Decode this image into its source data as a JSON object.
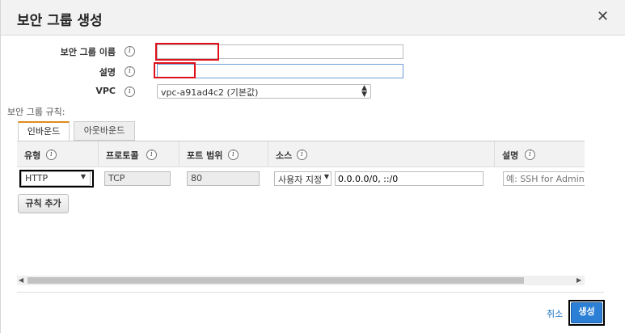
{
  "dialog": {
    "title": "보안 그룹 생성",
    "close_icon": "close-icon"
  },
  "form": {
    "name_label": "보안 그룹 이름",
    "name_value": "",
    "desc_label": "설명",
    "desc_value": "",
    "vpc_label": "VPC",
    "vpc_value": "vpc-a91ad4c2 (기본값)"
  },
  "rules": {
    "section_label": "보안 그룹 규칙:",
    "tabs": [
      {
        "label": "인바운드",
        "active": true
      },
      {
        "label": "아웃바운드",
        "active": false
      }
    ],
    "columns": [
      "유형",
      "프로토콜",
      "포트 범위",
      "소스",
      "설명"
    ],
    "row": {
      "type": "HTTP",
      "protocol": "TCP",
      "port": "80",
      "source_type": "사용자 지정",
      "source_value": "0.0.0.0/0, ::/0",
      "description_placeholder": "예: SSH for Admin Desktop"
    },
    "add_rule_label": "규칙 추가"
  },
  "footer": {
    "cancel_label": "취소",
    "create_label": "생성"
  },
  "colors": {
    "primary_button": "#2b7fd4",
    "active_tab_accent": "#e28b1c",
    "highlight_red": "#e0101a"
  }
}
